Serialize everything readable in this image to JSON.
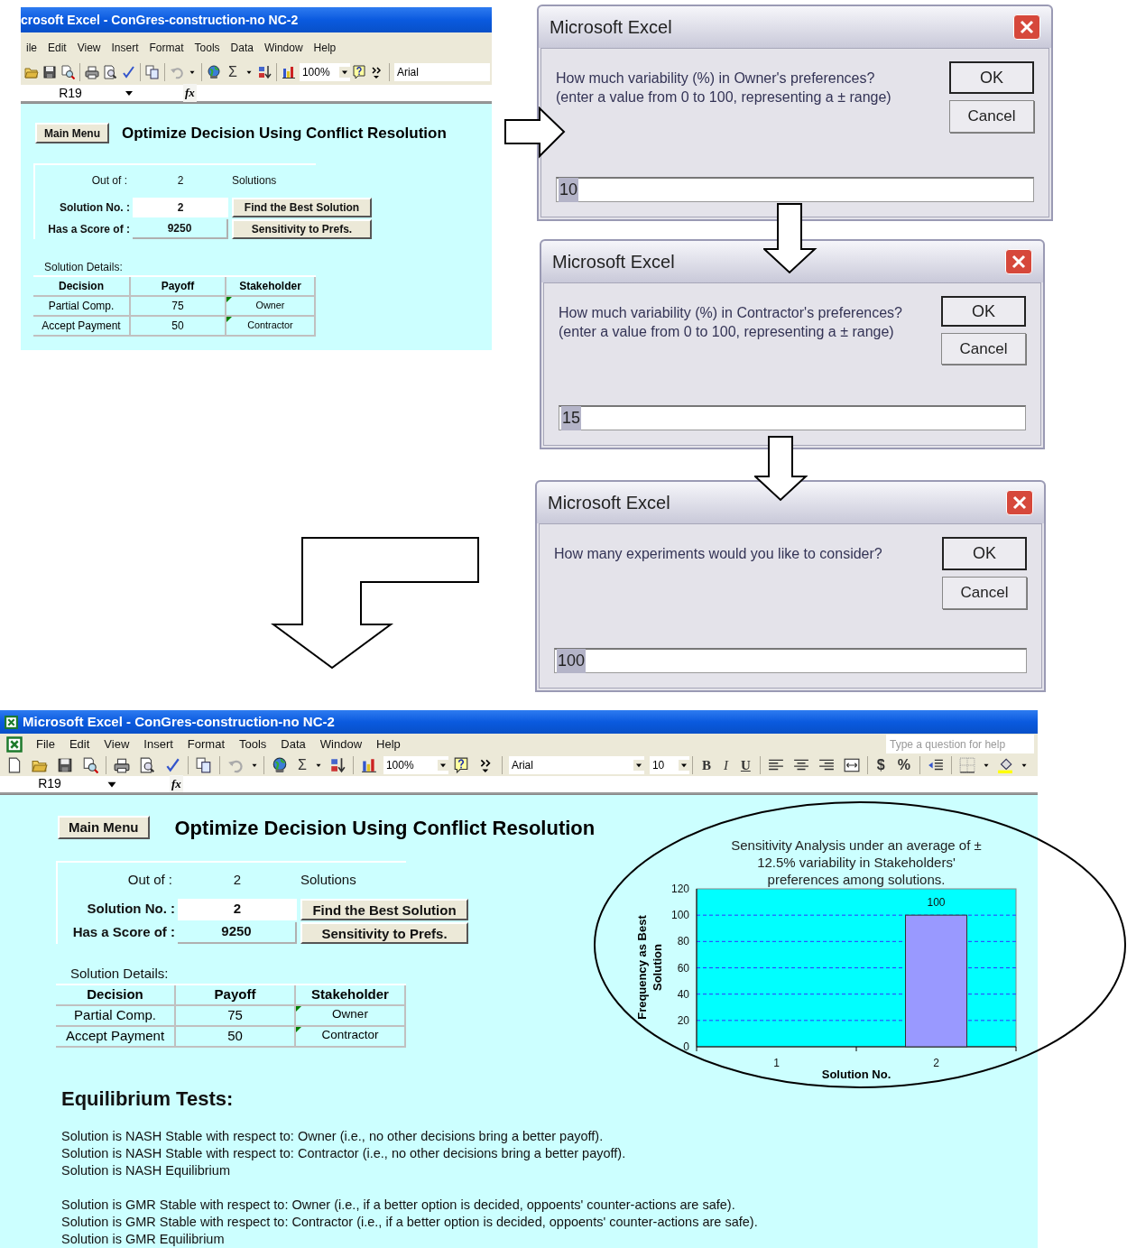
{
  "top_window": {
    "title": "crosoft Excel - ConGres-construction-no NC-2",
    "menu": [
      "ile",
      "Edit",
      "View",
      "Insert",
      "Format",
      "Tools",
      "Data",
      "Window",
      "Help"
    ],
    "toolbar": {
      "sum": "Σ",
      "zoom": "100%",
      "font": "Arial"
    },
    "name_box": "R19",
    "formula_label": "fx",
    "sheet": {
      "main_menu": "Main Menu",
      "heading": "Optimize Decision Using Conflict Resolution",
      "out_of_label": "Out of :",
      "out_of_value": "2",
      "out_of_unit": "Solutions",
      "solution_label": "Solution No. :",
      "solution_value": "2",
      "score_label": "Has a Score of :",
      "score_value": "9250",
      "buttons": [
        "Find the Best Solution",
        "Sensitivity to Prefs."
      ],
      "details_label": "Solution Details:",
      "columns": [
        "Decision",
        "Payoff",
        "Stakeholder"
      ],
      "rows": [
        {
          "decision": "Partial Comp.",
          "payoff": "75",
          "stakeholder": "Owner",
          "has_comment": true
        },
        {
          "decision": "Accept Payment",
          "payoff": "50",
          "stakeholder": "Contractor",
          "has_comment": true
        }
      ]
    }
  },
  "dialogs": [
    {
      "title": "Microsoft Excel",
      "prompt": [
        "How much variability (%) in Owner's preferences?",
        "(enter a value from 0 to 100, representing a ± range)"
      ],
      "ok": "OK",
      "cancel": "Cancel",
      "value": "10",
      "value_selected": true
    },
    {
      "title": "Microsoft Excel",
      "prompt": [
        "How much variability (%) in Contractor's preferences?",
        "(enter a value from 0 to 100, representing a ± range)"
      ],
      "ok": "OK",
      "cancel": "Cancel",
      "value": "15",
      "value_selected": true
    },
    {
      "title": "Microsoft Excel",
      "prompt": [
        "How many experiments would you like to consider?"
      ],
      "ok": "OK",
      "cancel": "Cancel",
      "value": "100",
      "value_selected": true
    }
  ],
  "bottom_window": {
    "title": "Microsoft Excel - ConGres-construction-no NC-2",
    "menu": [
      "File",
      "Edit",
      "View",
      "Insert",
      "Format",
      "Tools",
      "Data",
      "Window",
      "Help"
    ],
    "help_placeholder": "Type a question for help",
    "toolbar": {
      "sum": "Σ",
      "zoom": "100%",
      "font": "Arial",
      "font_size": "10",
      "format_buttons": [
        {
          "label": "B",
          "kind": "bold"
        },
        {
          "label": "I",
          "kind": "italic"
        },
        {
          "label": "U",
          "kind": "underline"
        }
      ],
      "number_buttons": [
        "$",
        "%"
      ]
    },
    "name_box": "R19",
    "formula_label": "fx",
    "sheet": {
      "main_menu": "Main Menu",
      "heading": "Optimize Decision Using Conflict Resolution",
      "out_of_label": "Out of :",
      "out_of_value": "2",
      "out_of_unit": "Solutions",
      "solution_label": "Solution No. :",
      "solution_value": "2",
      "score_label": "Has a Score of :",
      "score_value": "9250",
      "buttons": [
        "Find the Best Solution",
        "Sensitivity to Prefs."
      ],
      "details_label": "Solution Details:",
      "columns": [
        "Decision",
        "Payoff",
        "Stakeholder"
      ],
      "rows": [
        {
          "decision": "Partial Comp.",
          "payoff": "75",
          "stakeholder": "Owner",
          "has_comment": true
        },
        {
          "decision": "Accept Payment",
          "payoff": "50",
          "stakeholder": "Contractor",
          "has_comment": true
        }
      ]
    },
    "chart_data": {
      "type": "bar",
      "title": "Sensitivity Analysis under an average of ± 12.5% variability in Stakeholders' preferences among solutions.",
      "xlabel": "Solution No.",
      "ylabel": "Frequency as Best Solution",
      "categories": [
        "1",
        "2"
      ],
      "series": [
        {
          "color": "#9999ff",
          "values": [
            null,
            100
          ]
        }
      ],
      "ylim": [
        0,
        120
      ],
      "yticks": [
        0,
        20,
        40,
        60,
        80,
        100,
        120
      ],
      "grid": true,
      "data_labels": true
    },
    "equilibrium": {
      "heading": "Equilibrium Tests:",
      "groups": [
        [
          "Solution is NASH Stable with respect to: Owner (i.e., no other decisions bring a better payoff).",
          "Solution is NASH Stable with respect to: Contractor (i.e., no other decisions bring a better payoff).",
          "Solution is NASH Equilibrium"
        ],
        [
          "Solution is GMR Stable with respect to: Owner (i.e., if a better option is decided, oppoents' counter-actions are safe).",
          "Solution is GMR Stable with respect to: Contractor (i.e., if a better option is decided, oppoents' counter-actions are safe).",
          "Solution is GMR Equilibrium"
        ]
      ]
    }
  }
}
